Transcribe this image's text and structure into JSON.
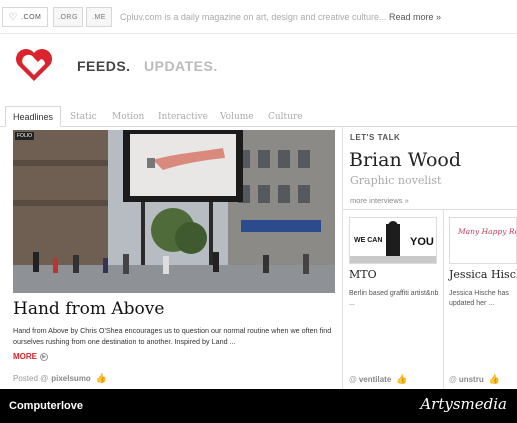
{
  "topbar": {
    "domains": [
      ".COM",
      ".ORG",
      ".ME"
    ],
    "tagline": "Cpluv.com is a daily magazine on art, design and creative culture...",
    "read_more": "Read more »"
  },
  "brand": {
    "nav_feeds": "FEEDS.",
    "nav_updates": "UPDATES.",
    "logo_color": "#d9232d"
  },
  "tabs": [
    "Headlines",
    "Static",
    "Motion",
    "Interactive",
    "Volume",
    "Culture"
  ],
  "feature": {
    "badge": "FOLIO",
    "title": "Hand from Above",
    "description": "Hand from Above by Chris O'Shea encourages us to question our normal routine when we often find ourselves rushing from one destination to another. Inspired by Land ...",
    "more": "MORE",
    "posted_label": "Posted @",
    "posted_user": "pixelsumo"
  },
  "sidebar": {
    "heading": "LET'S TALK",
    "name": "Brian Wood",
    "role": "Graphic novelist",
    "more_interviews": "more interviews »",
    "cards": [
      {
        "title": "MTO",
        "desc": "Berlin based graffiti artist&nb ...",
        "user": "ventilate",
        "img_text_1": "WE CAN",
        "img_text_2": "YOU"
      },
      {
        "title": "Jessica Hisch",
        "desc": "Jessica Hische has updated her ...",
        "user": "unstru",
        "img_text_1": "Many Happy Returns"
      }
    ]
  },
  "caption": {
    "left": "Computerlove",
    "right": "Artysmedia"
  }
}
